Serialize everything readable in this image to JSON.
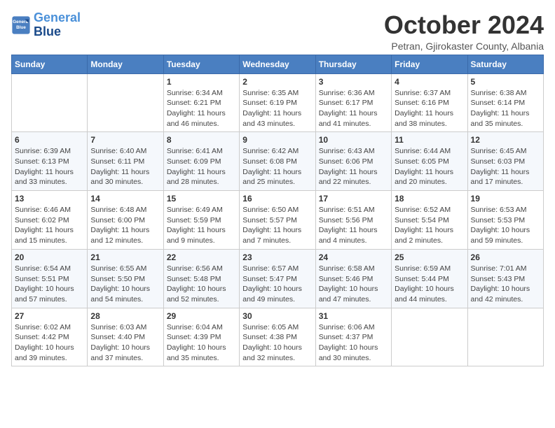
{
  "header": {
    "logo_line1": "General",
    "logo_line2": "Blue",
    "month": "October 2024",
    "location": "Petran, Gjirokaster County, Albania"
  },
  "weekdays": [
    "Sunday",
    "Monday",
    "Tuesday",
    "Wednesday",
    "Thursday",
    "Friday",
    "Saturday"
  ],
  "weeks": [
    [
      {
        "day": "",
        "detail": ""
      },
      {
        "day": "",
        "detail": ""
      },
      {
        "day": "1",
        "detail": "Sunrise: 6:34 AM\nSunset: 6:21 PM\nDaylight: 11 hours and 46 minutes."
      },
      {
        "day": "2",
        "detail": "Sunrise: 6:35 AM\nSunset: 6:19 PM\nDaylight: 11 hours and 43 minutes."
      },
      {
        "day": "3",
        "detail": "Sunrise: 6:36 AM\nSunset: 6:17 PM\nDaylight: 11 hours and 41 minutes."
      },
      {
        "day": "4",
        "detail": "Sunrise: 6:37 AM\nSunset: 6:16 PM\nDaylight: 11 hours and 38 minutes."
      },
      {
        "day": "5",
        "detail": "Sunrise: 6:38 AM\nSunset: 6:14 PM\nDaylight: 11 hours and 35 minutes."
      }
    ],
    [
      {
        "day": "6",
        "detail": "Sunrise: 6:39 AM\nSunset: 6:13 PM\nDaylight: 11 hours and 33 minutes."
      },
      {
        "day": "7",
        "detail": "Sunrise: 6:40 AM\nSunset: 6:11 PM\nDaylight: 11 hours and 30 minutes."
      },
      {
        "day": "8",
        "detail": "Sunrise: 6:41 AM\nSunset: 6:09 PM\nDaylight: 11 hours and 28 minutes."
      },
      {
        "day": "9",
        "detail": "Sunrise: 6:42 AM\nSunset: 6:08 PM\nDaylight: 11 hours and 25 minutes."
      },
      {
        "day": "10",
        "detail": "Sunrise: 6:43 AM\nSunset: 6:06 PM\nDaylight: 11 hours and 22 minutes."
      },
      {
        "day": "11",
        "detail": "Sunrise: 6:44 AM\nSunset: 6:05 PM\nDaylight: 11 hours and 20 minutes."
      },
      {
        "day": "12",
        "detail": "Sunrise: 6:45 AM\nSunset: 6:03 PM\nDaylight: 11 hours and 17 minutes."
      }
    ],
    [
      {
        "day": "13",
        "detail": "Sunrise: 6:46 AM\nSunset: 6:02 PM\nDaylight: 11 hours and 15 minutes."
      },
      {
        "day": "14",
        "detail": "Sunrise: 6:48 AM\nSunset: 6:00 PM\nDaylight: 11 hours and 12 minutes."
      },
      {
        "day": "15",
        "detail": "Sunrise: 6:49 AM\nSunset: 5:59 PM\nDaylight: 11 hours and 9 minutes."
      },
      {
        "day": "16",
        "detail": "Sunrise: 6:50 AM\nSunset: 5:57 PM\nDaylight: 11 hours and 7 minutes."
      },
      {
        "day": "17",
        "detail": "Sunrise: 6:51 AM\nSunset: 5:56 PM\nDaylight: 11 hours and 4 minutes."
      },
      {
        "day": "18",
        "detail": "Sunrise: 6:52 AM\nSunset: 5:54 PM\nDaylight: 11 hours and 2 minutes."
      },
      {
        "day": "19",
        "detail": "Sunrise: 6:53 AM\nSunset: 5:53 PM\nDaylight: 10 hours and 59 minutes."
      }
    ],
    [
      {
        "day": "20",
        "detail": "Sunrise: 6:54 AM\nSunset: 5:51 PM\nDaylight: 10 hours and 57 minutes."
      },
      {
        "day": "21",
        "detail": "Sunrise: 6:55 AM\nSunset: 5:50 PM\nDaylight: 10 hours and 54 minutes."
      },
      {
        "day": "22",
        "detail": "Sunrise: 6:56 AM\nSunset: 5:48 PM\nDaylight: 10 hours and 52 minutes."
      },
      {
        "day": "23",
        "detail": "Sunrise: 6:57 AM\nSunset: 5:47 PM\nDaylight: 10 hours and 49 minutes."
      },
      {
        "day": "24",
        "detail": "Sunrise: 6:58 AM\nSunset: 5:46 PM\nDaylight: 10 hours and 47 minutes."
      },
      {
        "day": "25",
        "detail": "Sunrise: 6:59 AM\nSunset: 5:44 PM\nDaylight: 10 hours and 44 minutes."
      },
      {
        "day": "26",
        "detail": "Sunrise: 7:01 AM\nSunset: 5:43 PM\nDaylight: 10 hours and 42 minutes."
      }
    ],
    [
      {
        "day": "27",
        "detail": "Sunrise: 6:02 AM\nSunset: 4:42 PM\nDaylight: 10 hours and 39 minutes."
      },
      {
        "day": "28",
        "detail": "Sunrise: 6:03 AM\nSunset: 4:40 PM\nDaylight: 10 hours and 37 minutes."
      },
      {
        "day": "29",
        "detail": "Sunrise: 6:04 AM\nSunset: 4:39 PM\nDaylight: 10 hours and 35 minutes."
      },
      {
        "day": "30",
        "detail": "Sunrise: 6:05 AM\nSunset: 4:38 PM\nDaylight: 10 hours and 32 minutes."
      },
      {
        "day": "31",
        "detail": "Sunrise: 6:06 AM\nSunset: 4:37 PM\nDaylight: 10 hours and 30 minutes."
      },
      {
        "day": "",
        "detail": ""
      },
      {
        "day": "",
        "detail": ""
      }
    ]
  ]
}
